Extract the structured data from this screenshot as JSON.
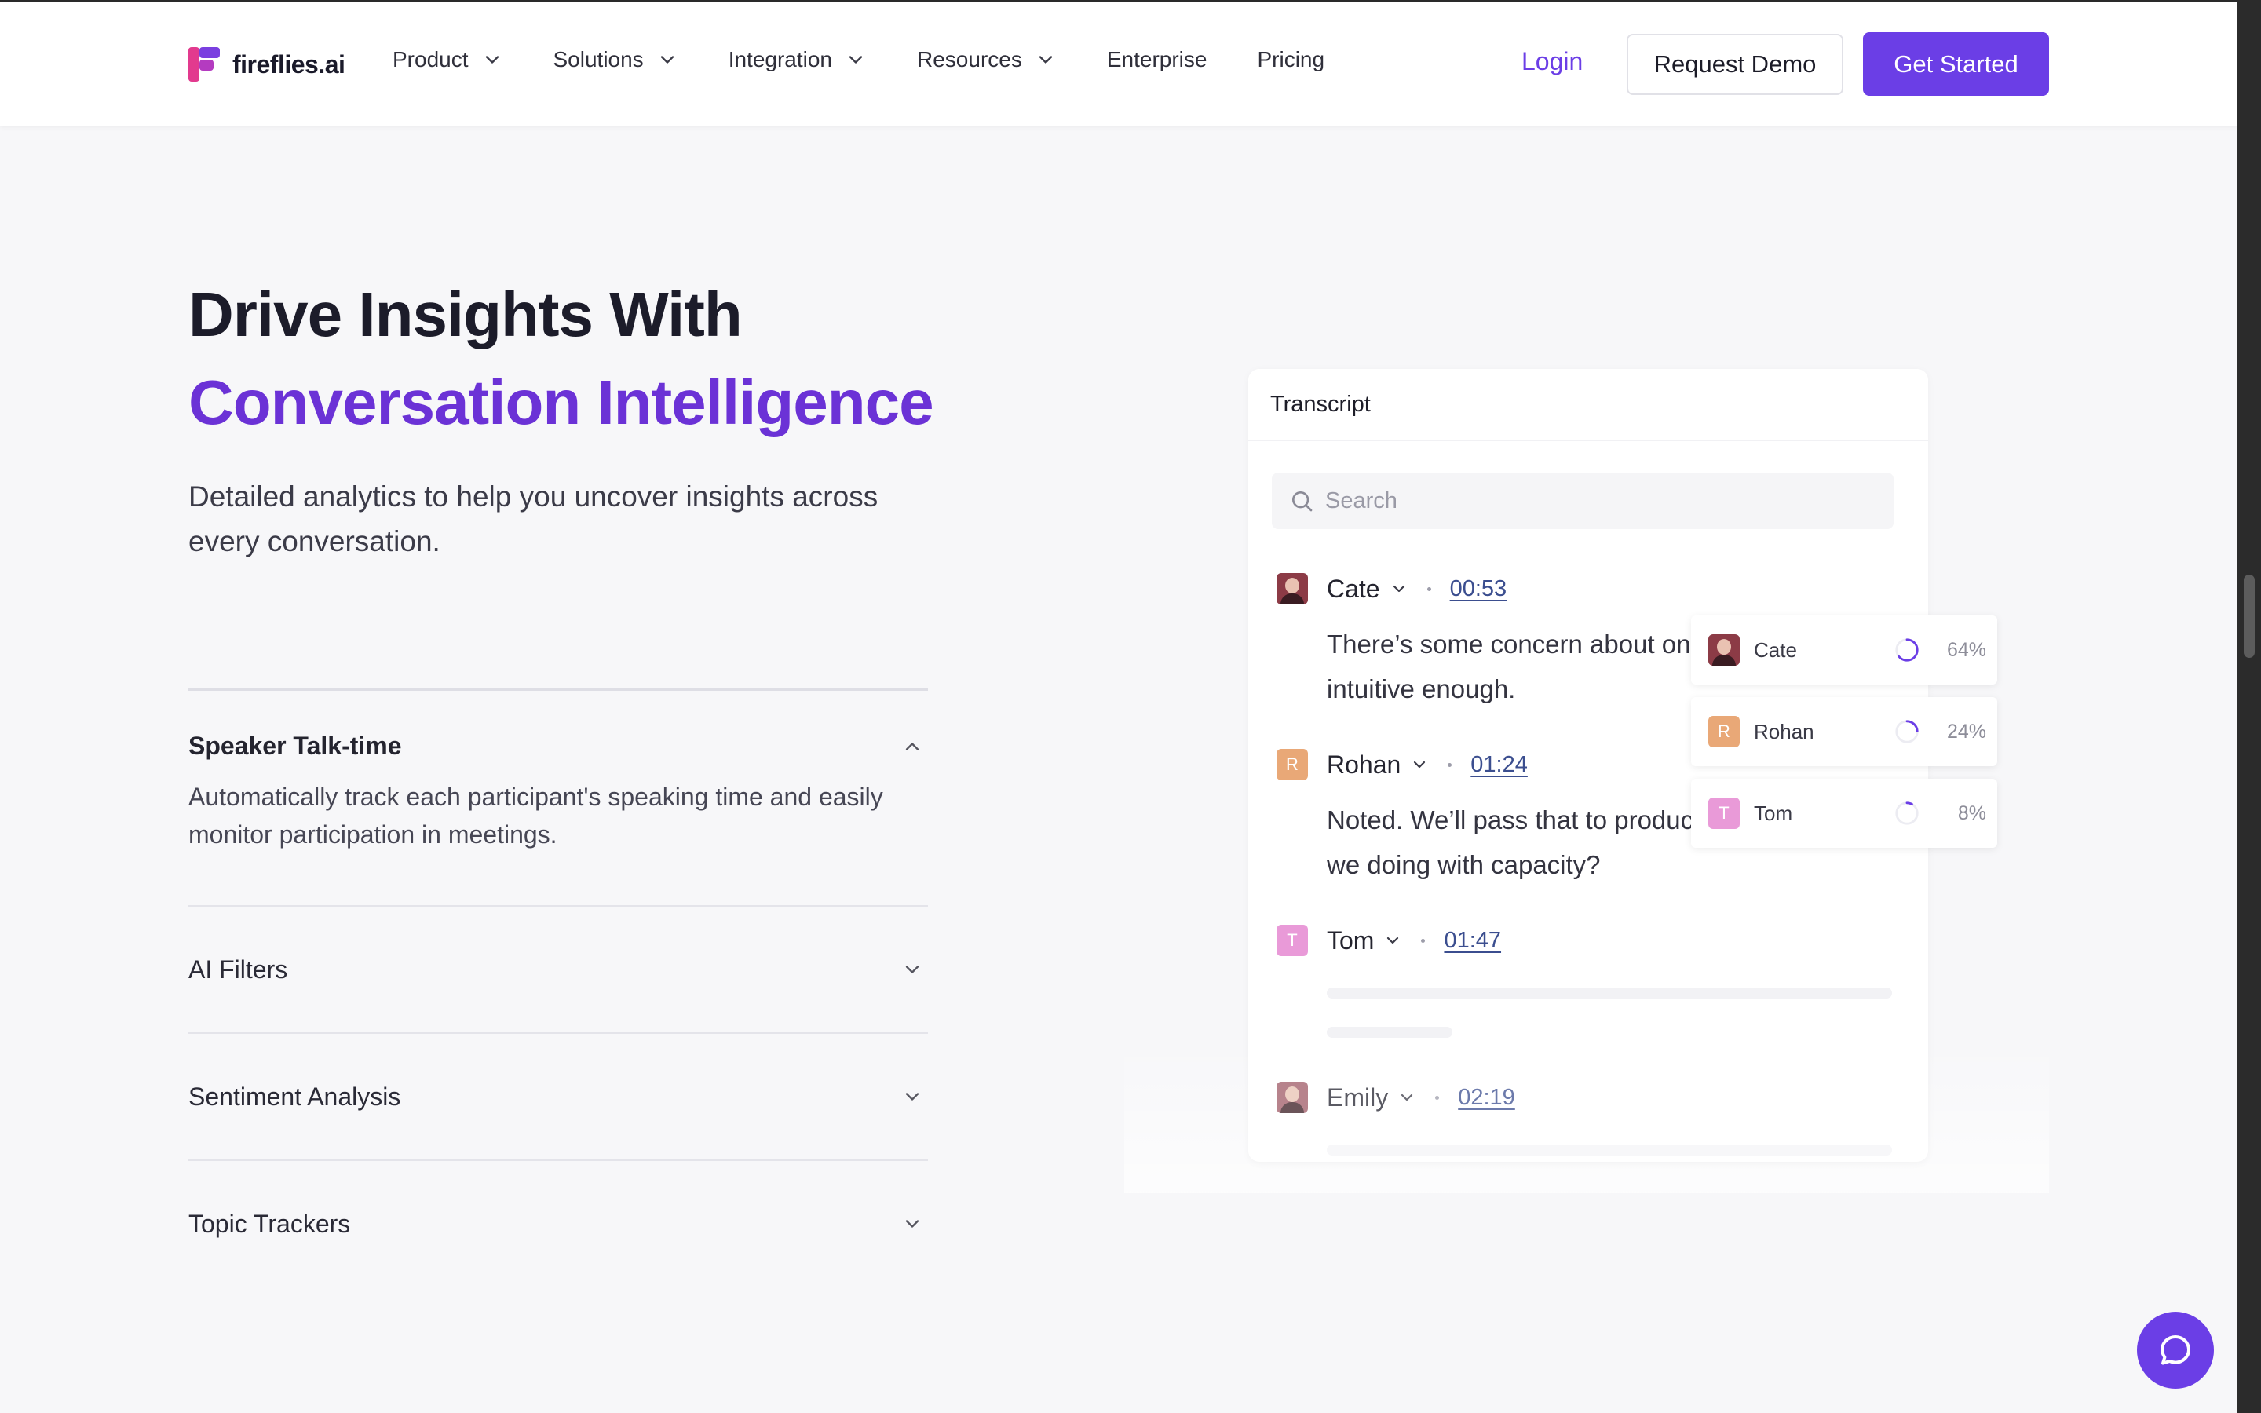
{
  "nav": {
    "logo_text": "fireflies.ai",
    "items": [
      {
        "label": "Product",
        "dropdown": true
      },
      {
        "label": "Solutions",
        "dropdown": true
      },
      {
        "label": "Integration",
        "dropdown": true
      },
      {
        "label": "Resources",
        "dropdown": true
      },
      {
        "label": "Enterprise",
        "dropdown": false
      },
      {
        "label": "Pricing",
        "dropdown": false
      }
    ],
    "login": "Login",
    "request_demo": "Request Demo",
    "get_started": "Get Started"
  },
  "hero": {
    "title_line1": "Drive Insights With",
    "title_line2": "Conversation Intelligence",
    "subtitle": "Detailed analytics to help you uncover insights across every conversation."
  },
  "accordion": [
    {
      "title": "Speaker Talk-time",
      "body": "Automatically track each participant's speaking time and easily monitor participation in meetings.",
      "open": true
    },
    {
      "title": "AI Filters",
      "open": false
    },
    {
      "title": "Sentiment Analysis",
      "open": false
    },
    {
      "title": "Topic Trackers",
      "open": false
    }
  ],
  "transcript": {
    "title": "Transcript",
    "search_placeholder": "Search",
    "entries": [
      {
        "speaker": "Cate",
        "time": "00:53",
        "avatar": "photo",
        "text": "There’s some concern about on feel it's not intuitive enough."
      },
      {
        "speaker": "Rohan",
        "time": "01:24",
        "avatar": "R",
        "text": "Noted. We’ll pass that to produc front—how are we doing with capacity?"
      },
      {
        "speaker": "Tom",
        "time": "01:47",
        "avatar": "T",
        "text": ""
      },
      {
        "speaker": "Emily",
        "time": "02:19",
        "avatar": "photo",
        "text": ""
      }
    ]
  },
  "talk_time": [
    {
      "name": "Cate",
      "percent": 64,
      "percent_label": "64%",
      "avatar": "photo"
    },
    {
      "name": "Rohan",
      "percent": 24,
      "percent_label": "24%",
      "avatar": "R"
    },
    {
      "name": "Tom",
      "percent": 8,
      "percent_label": "8%",
      "avatar": "T"
    }
  ],
  "colors": {
    "brand": "#6b3ee6",
    "heading_accent": "#6b32d6",
    "rohan_avatar": "#e9a877",
    "tom_avatar": "#e99ad8",
    "timestamp": "#3b4e8f"
  },
  "icons": {
    "nav_dropdown": "chevron-down-icon",
    "search": "search-icon",
    "chat": "chat-bubble-icon"
  }
}
